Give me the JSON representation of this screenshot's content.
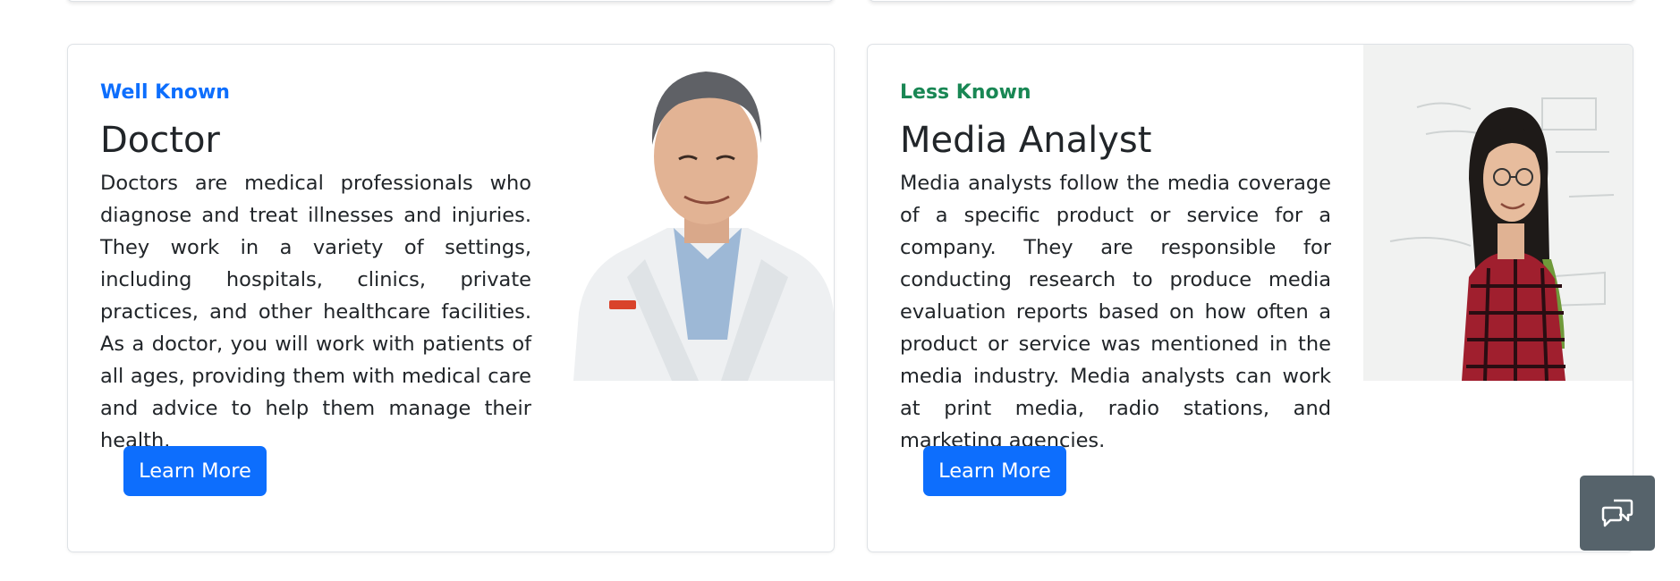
{
  "cards": [
    {
      "tag": "Well Known",
      "tag_color": "#0d6efd",
      "title": "Doctor",
      "description": "Doctors are medical professionals who diagnose and treat illnesses and injuries. They work in a variety of settings, including hospitals, clinics, private practices, and other healthcare facilities. As a doctor, you will work with patients of all ages, providing them with medical care and advice to help them manage their health.",
      "button_label": "Learn More",
      "image": "portrait of a smiling male doctor in a white coat"
    },
    {
      "tag": "Less Known",
      "tag_color": "#198754",
      "title": "Media Analyst",
      "description": "Media analysts follow the media coverage of a specific product or service for a company. They are responsible for conducting research to produce media evaluation reports based on how often a product or service was mentioned in the media industry. Media analysts can work at print media, radio stations, and marketing agencies.",
      "button_label": "Learn More",
      "image": "smiling woman with glasses in a red plaid shirt in front of a whiteboard"
    }
  ],
  "chat_button": {
    "icon": "chat-bubbles-icon"
  },
  "colors": {
    "primary": "#0d6efd",
    "success": "#198754",
    "fab": "#56636b"
  }
}
